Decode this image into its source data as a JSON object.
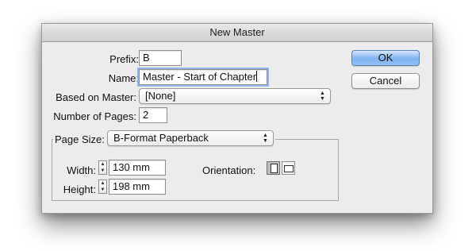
{
  "dialog": {
    "title": "New Master"
  },
  "prefix": {
    "label": "Prefix:",
    "value": "B"
  },
  "name": {
    "label": "Name:",
    "value": "Master - Start of Chapter"
  },
  "based_on": {
    "label": "Based on Master:",
    "value": "[None]"
  },
  "pages": {
    "label": "Number of Pages:",
    "value": "2"
  },
  "page_size": {
    "label": "Page Size:",
    "value": "B-Format Paperback"
  },
  "width": {
    "label": "Width:",
    "value": "130 mm"
  },
  "height": {
    "label": "Height:",
    "value": "198 mm"
  },
  "orientation": {
    "label": "Orientation:",
    "selected": "portrait"
  },
  "buttons": {
    "ok": "OK",
    "cancel": "Cancel"
  },
  "icons": {
    "select_arrows": "up-down-arrows",
    "stepper": "up-down-stepper",
    "portrait": "portrait-icon",
    "landscape": "landscape-icon"
  },
  "colors": {
    "default_button": "#7fb2ef",
    "dialog_bg": "#ececec"
  }
}
